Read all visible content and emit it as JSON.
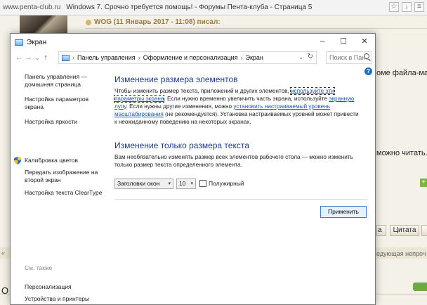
{
  "browser": {
    "url": "www.penta-club.ru",
    "page_title": "Windows 7. Срочно требуется помощь! - Форумы Пента-клуба - Страница 5",
    "icons": [
      "bookmark-icon",
      "download-icon",
      "menu-icon"
    ]
  },
  "forum": {
    "post_header": "WOG (11 Январь 2017 - 11:08) писал:",
    "peek_text_1": "оме файла-ман",
    "peek_text_2": "можно читать.",
    "quote_button": "Цитата",
    "button_a": "а",
    "peek_text_3": "едующая непроч",
    "peek_letter": "О"
  },
  "window": {
    "title": "Экран",
    "controls": {
      "minimize": "–",
      "maximize": "☐",
      "close": "✕"
    },
    "breadcrumb": [
      "Панель управления",
      "Оформление и персонализация",
      "Экран"
    ],
    "search_placeholder": "Поиск в Пан...",
    "sidebar": {
      "home_link": "Панель управления — домашняя страница",
      "links": [
        "Настройка параметров экрана",
        "Настройка яркости",
        "Калибровка цветов",
        "Передать изображение на второй экран",
        "Настройка текста ClearType"
      ],
      "see_also_title": "См. также",
      "see_also_links": [
        "Персонализация",
        "Устройства и принтеры"
      ]
    },
    "main": {
      "heading_1": "Изменение размера элементов",
      "desc_1_a": "Чтобы изменить размер текста, приложений и других элементов, ",
      "desc_1_link_1": "используйте эти параметры экрана",
      "desc_1_b": ". Если нужно временно увеличить часть экрана, используйте ",
      "desc_1_link_2": "экранную лупу",
      "desc_1_c": ". Если нужны другие изменения, можно ",
      "desc_1_link_3": "установить настраиваемый уровень масштабирования",
      "desc_1_d": " (не рекомендуется). Установка настраиваемых уровней может привести к неожиданному поведению на некоторых экранах.",
      "heading_2": "Изменение только размера текста",
      "desc_2": "Вам необязательно изменять размер всех элементов рабочего стола — можно изменить только размер текста определенного элемента.",
      "font_select": "Заголовки окон",
      "size_select": "10",
      "bold_label": "Полужирный",
      "bold_checked": false,
      "apply_button": "Применить"
    }
  }
}
